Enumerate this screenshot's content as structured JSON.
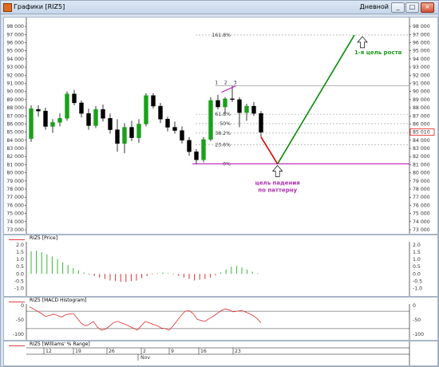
{
  "window": {
    "title": "Графики [RIZ5]",
    "period": "Дневной",
    "buttons": {
      "minimize": "_",
      "maximize": "□",
      "close": "×"
    }
  },
  "price_pane": {
    "y_labels": [
      "98 000",
      "97 000",
      "96 000",
      "95 000",
      "94 000",
      "93 000",
      "92 000",
      "91 000",
      "90 000",
      "89 000",
      "88 000",
      "87 000",
      "86 000",
      "85 000",
      "84 000",
      "83 000",
      "82 000",
      "81 000",
      "80 000",
      "79 000",
      "78 000",
      "77 000",
      "76 000",
      "75 000",
      "74 000",
      "73 000"
    ],
    "y_values": [
      98000,
      97000,
      96000,
      95000,
      94000,
      93000,
      92000,
      91000,
      90000,
      89000,
      88000,
      87000,
      86000,
      85000,
      84000,
      83000,
      82000,
      81000,
      80000,
      79000,
      78000,
      77000,
      76000,
      75000,
      74000,
      73000
    ],
    "current_price_label": "85 010",
    "current_price_color": "#e00000",
    "fib_levels": [
      {
        "label": "161.8%",
        "value": 96940
      },
      {
        "label": "61.8%",
        "value": 87210
      },
      {
        "label": "50%",
        "value": 86050
      },
      {
        "label": "38.2%",
        "value": 84890
      },
      {
        "label": "23.6%",
        "value": 83450
      },
      {
        "label": "0%",
        "value": 81100
      }
    ],
    "annotation_up": "1-я цель роста",
    "annotation_down": "цель падения\nпо паттерну",
    "annotation_up_color": "#1a9a1a",
    "annotation_down_color": "#b030b0",
    "candle_bull_color": "#1aa01a",
    "candle_bear_color": "#000000"
  },
  "chart_data": [
    {
      "type": "candlestick",
      "series_name": "RIZ5",
      "ylim": [
        73000,
        98500
      ],
      "candles": [
        {
          "o": 84200,
          "h": 88300,
          "l": 83800,
          "c": 87900
        },
        {
          "o": 87800,
          "h": 88300,
          "l": 86900,
          "c": 87600
        },
        {
          "o": 87600,
          "h": 88000,
          "l": 85300,
          "c": 85700
        },
        {
          "o": 85700,
          "h": 86600,
          "l": 84900,
          "c": 86200
        },
        {
          "o": 86200,
          "h": 87300,
          "l": 85700,
          "c": 86700
        },
        {
          "o": 86700,
          "h": 90000,
          "l": 86400,
          "c": 89700
        },
        {
          "o": 89700,
          "h": 90200,
          "l": 88300,
          "c": 88600
        },
        {
          "o": 88600,
          "h": 88900,
          "l": 86800,
          "c": 87300
        },
        {
          "o": 87300,
          "h": 87900,
          "l": 85300,
          "c": 85800
        },
        {
          "o": 85800,
          "h": 88200,
          "l": 85500,
          "c": 87800
        },
        {
          "o": 87800,
          "h": 88400,
          "l": 86300,
          "c": 86700
        },
        {
          "o": 86700,
          "h": 87300,
          "l": 84800,
          "c": 85300
        },
        {
          "o": 85300,
          "h": 86600,
          "l": 82600,
          "c": 83600
        },
        {
          "o": 83600,
          "h": 86100,
          "l": 82400,
          "c": 85600
        },
        {
          "o": 85600,
          "h": 86400,
          "l": 83900,
          "c": 84300
        },
        {
          "o": 84300,
          "h": 86600,
          "l": 83700,
          "c": 86000
        },
        {
          "o": 86000,
          "h": 89800,
          "l": 85700,
          "c": 89500
        },
        {
          "o": 89500,
          "h": 89800,
          "l": 87900,
          "c": 88200
        },
        {
          "o": 88200,
          "h": 88600,
          "l": 86100,
          "c": 86600
        },
        {
          "o": 86600,
          "h": 86900,
          "l": 85100,
          "c": 85600
        },
        {
          "o": 85600,
          "h": 86300,
          "l": 84800,
          "c": 85200
        },
        {
          "o": 85200,
          "h": 85700,
          "l": 83600,
          "c": 84000
        },
        {
          "o": 84000,
          "h": 84400,
          "l": 82100,
          "c": 82600
        },
        {
          "o": 82600,
          "h": 82900,
          "l": 81100,
          "c": 81600
        },
        {
          "o": 81600,
          "h": 84400,
          "l": 81300,
          "c": 84100
        },
        {
          "o": 84100,
          "h": 89300,
          "l": 83900,
          "c": 88900
        },
        {
          "o": 88900,
          "h": 89600,
          "l": 87800,
          "c": 88100
        },
        {
          "o": 88100,
          "h": 89300,
          "l": 87300,
          "c": 89100
        },
        {
          "o": 89100,
          "h": 90700,
          "l": 88700,
          "c": 89000
        },
        {
          "o": 89000,
          "h": 89300,
          "l": 85600,
          "c": 87400
        },
        {
          "o": 87400,
          "h": 88500,
          "l": 86400,
          "c": 88200
        },
        {
          "o": 88200,
          "h": 88700,
          "l": 87000,
          "c": 87300
        },
        {
          "o": 87300,
          "h": 87600,
          "l": 84400,
          "c": 85000
        }
      ],
      "overlays": {
        "horizontal_line_value": 90700,
        "zero_line_value": 81100,
        "pattern_points": [
          {
            "i": 26.5,
            "v": 89900
          },
          {
            "i": 28.5,
            "v": 90700
          }
        ],
        "pattern_labels": [
          "1",
          "2",
          "3"
        ],
        "down_leg": [
          {
            "i": 32,
            "v": 84400
          },
          {
            "i": 34.3,
            "v": 81100
          }
        ],
        "up_leg": [
          {
            "i": 34.3,
            "v": 81100
          },
          {
            "i": 45,
            "v": 96940
          }
        ]
      }
    },
    {
      "type": "bar",
      "title": "RIZ5 [Price]",
      "ylim": [
        -1.3,
        2.1
      ],
      "y_ticks": [
        "2.0",
        "1.5",
        "1.0",
        "0.5",
        "0.0",
        "-0.5",
        "-1.0"
      ],
      "y_tick_values": [
        2.0,
        1.5,
        1.0,
        0.5,
        0.0,
        -0.5,
        -1.0
      ],
      "values": [
        1.55,
        1.6,
        1.5,
        1.35,
        1.2,
        1.0,
        0.8,
        0.6,
        0.4,
        0.25,
        0.1,
        -0.05,
        -0.15,
        -0.25,
        -0.35,
        -0.45,
        -0.5,
        -0.55,
        -0.55,
        -0.5,
        -0.45,
        -0.3,
        -0.15,
        -0.05,
        0.05,
        0.1,
        0.05,
        -0.05,
        -0.15,
        -0.25,
        -0.35,
        -0.45,
        -0.4,
        -0.35,
        -0.25,
        -0.1,
        0.1,
        0.3,
        0.5,
        0.55,
        0.45,
        0.3,
        0.15,
        0.05
      ]
    },
    {
      "type": "line",
      "title": "RIZ5 [MACD Histogram]",
      "ylim": [
        -105,
        5
      ],
      "y_ticks": [
        "0",
        "-50",
        "-100"
      ],
      "y_tick_values": [
        0,
        -50,
        -100
      ],
      "values": [
        -5,
        -12,
        -20,
        -28,
        -38,
        -35,
        -30,
        -35,
        -40,
        -32,
        -30,
        -28,
        -45,
        -62,
        -70,
        -65,
        -55,
        -75,
        -85,
        -82,
        -72,
        -60,
        -55,
        -60,
        -65,
        -72,
        -78,
        -85,
        -70,
        -55,
        -60,
        -65,
        -70,
        -78,
        -80,
        -85,
        -70,
        -52,
        -35,
        -20,
        -18,
        -28,
        -48,
        -52,
        -55,
        -45,
        -38,
        -28,
        -18,
        -12,
        -15,
        -22,
        -20,
        -17,
        -22,
        -28,
        -35,
        -45,
        -60
      ]
    },
    {
      "type": "axis",
      "title": "RIZ5 [Williams' % Range]",
      "x_tick_labels": [
        "12",
        "19",
        "26",
        "2",
        "9",
        "16",
        "23"
      ],
      "x_month_label": "Nov"
    }
  ]
}
